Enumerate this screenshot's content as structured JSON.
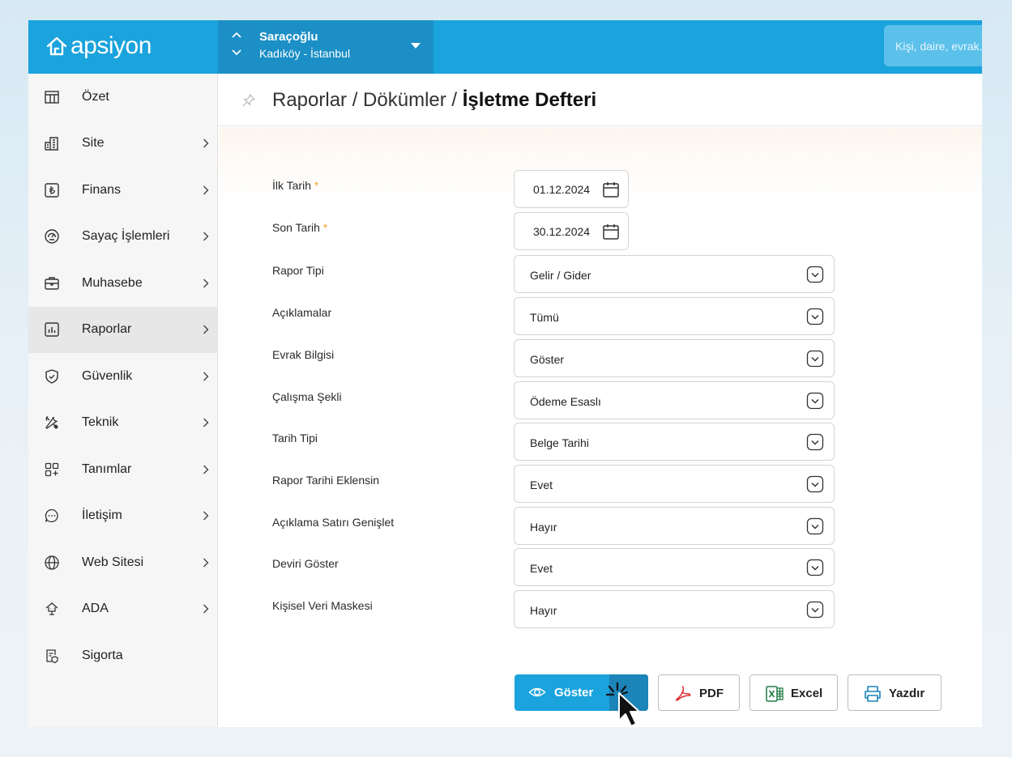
{
  "brand": {
    "name": "apsiyon"
  },
  "site_switcher": {
    "name": "Saraçoğlu",
    "location": "Kadıköy - İstanbul"
  },
  "search": {
    "placeholder": "Kişi, daire, evrak..."
  },
  "sidebar": {
    "items": [
      {
        "label": "Özet",
        "icon": "dashboard-icon",
        "has_chevron": false,
        "active": false
      },
      {
        "label": "Site",
        "icon": "building-icon",
        "has_chevron": true,
        "active": false
      },
      {
        "label": "Finans",
        "icon": "lira-icon",
        "has_chevron": true,
        "active": false
      },
      {
        "label": "Sayaç İşlemleri",
        "icon": "gauge-icon",
        "has_chevron": true,
        "active": false
      },
      {
        "label": "Muhasebe",
        "icon": "briefcase-icon",
        "has_chevron": true,
        "active": false
      },
      {
        "label": "Raporlar",
        "icon": "report-chart-icon",
        "has_chevron": true,
        "active": true
      },
      {
        "label": "Güvenlik",
        "icon": "shield-icon",
        "has_chevron": true,
        "active": false
      },
      {
        "label": "Teknik",
        "icon": "tools-icon",
        "has_chevron": true,
        "active": false
      },
      {
        "label": "Tanımlar",
        "icon": "grid-plus-icon",
        "has_chevron": true,
        "active": false
      },
      {
        "label": "İletişim",
        "icon": "chat-icon",
        "has_chevron": true,
        "active": false
      },
      {
        "label": "Web Sitesi",
        "icon": "globe-icon",
        "has_chevron": true,
        "active": false
      },
      {
        "label": "ADA",
        "icon": "ai-assistant-icon",
        "has_chevron": true,
        "active": false
      },
      {
        "label": "Sigorta",
        "icon": "insurance-doc-icon",
        "has_chevron": false,
        "active": false
      }
    ]
  },
  "header": {
    "breadcrumb_prefix": "Raporlar / Dökümler / ",
    "breadcrumb_current": "İşletme Defteri"
  },
  "form": {
    "start_date": {
      "label": "İlk Tarih",
      "required_mark": "*",
      "value": "01.12.2024"
    },
    "end_date": {
      "label": "Son Tarih",
      "required_mark": "*",
      "value": "30.12.2024"
    },
    "selects": [
      {
        "label": "Rapor Tipi",
        "value": "Gelir / Gider"
      },
      {
        "label": "Açıklamalar",
        "value": "Tümü"
      },
      {
        "label": "Evrak Bilgisi",
        "value": "Göster"
      },
      {
        "label": "Çalışma Şekli",
        "value": "Ödeme Esaslı"
      },
      {
        "label": "Tarih Tipi",
        "value": "Belge Tarihi"
      },
      {
        "label": "Rapor Tarihi Eklensin",
        "value": "Evet"
      },
      {
        "label": "Açıklama Satırı Genişlet",
        "value": "Hayır"
      },
      {
        "label": "Deviri Göster",
        "value": "Evet"
      },
      {
        "label": "Kişisel Veri Maskesi",
        "value": "Hayır"
      }
    ]
  },
  "actions": {
    "show_label": "Göster",
    "pdf_label": "PDF",
    "excel_label": "Excel",
    "print_label": "Yazdır"
  },
  "colors": {
    "primary": "#1aa3dd",
    "primary_dark": "#1b8fc6",
    "required": "#f5a32c",
    "pdf_red": "#e3262c",
    "excel_green": "#1e7b45"
  }
}
